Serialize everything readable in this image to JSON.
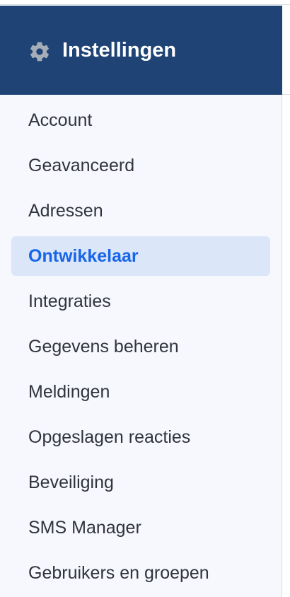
{
  "header": {
    "icon": "gear-icon",
    "title": "Instellingen"
  },
  "menu": {
    "active_index": 3,
    "items": [
      {
        "label": "Account"
      },
      {
        "label": "Geavanceerd"
      },
      {
        "label": "Adressen"
      },
      {
        "label": "Ontwikkelaar"
      },
      {
        "label": "Integraties"
      },
      {
        "label": "Gegevens beheren"
      },
      {
        "label": "Meldingen"
      },
      {
        "label": "Opgeslagen reacties"
      },
      {
        "label": "Beveiliging"
      },
      {
        "label": "SMS Manager"
      },
      {
        "label": "Gebruikers en groepen"
      }
    ]
  },
  "colors": {
    "header_background": "#1e4374",
    "sidebar_background": "#f6f8fd",
    "active_background": "#dce6f9",
    "active_text": "#1765e8",
    "text": "#30343b"
  }
}
